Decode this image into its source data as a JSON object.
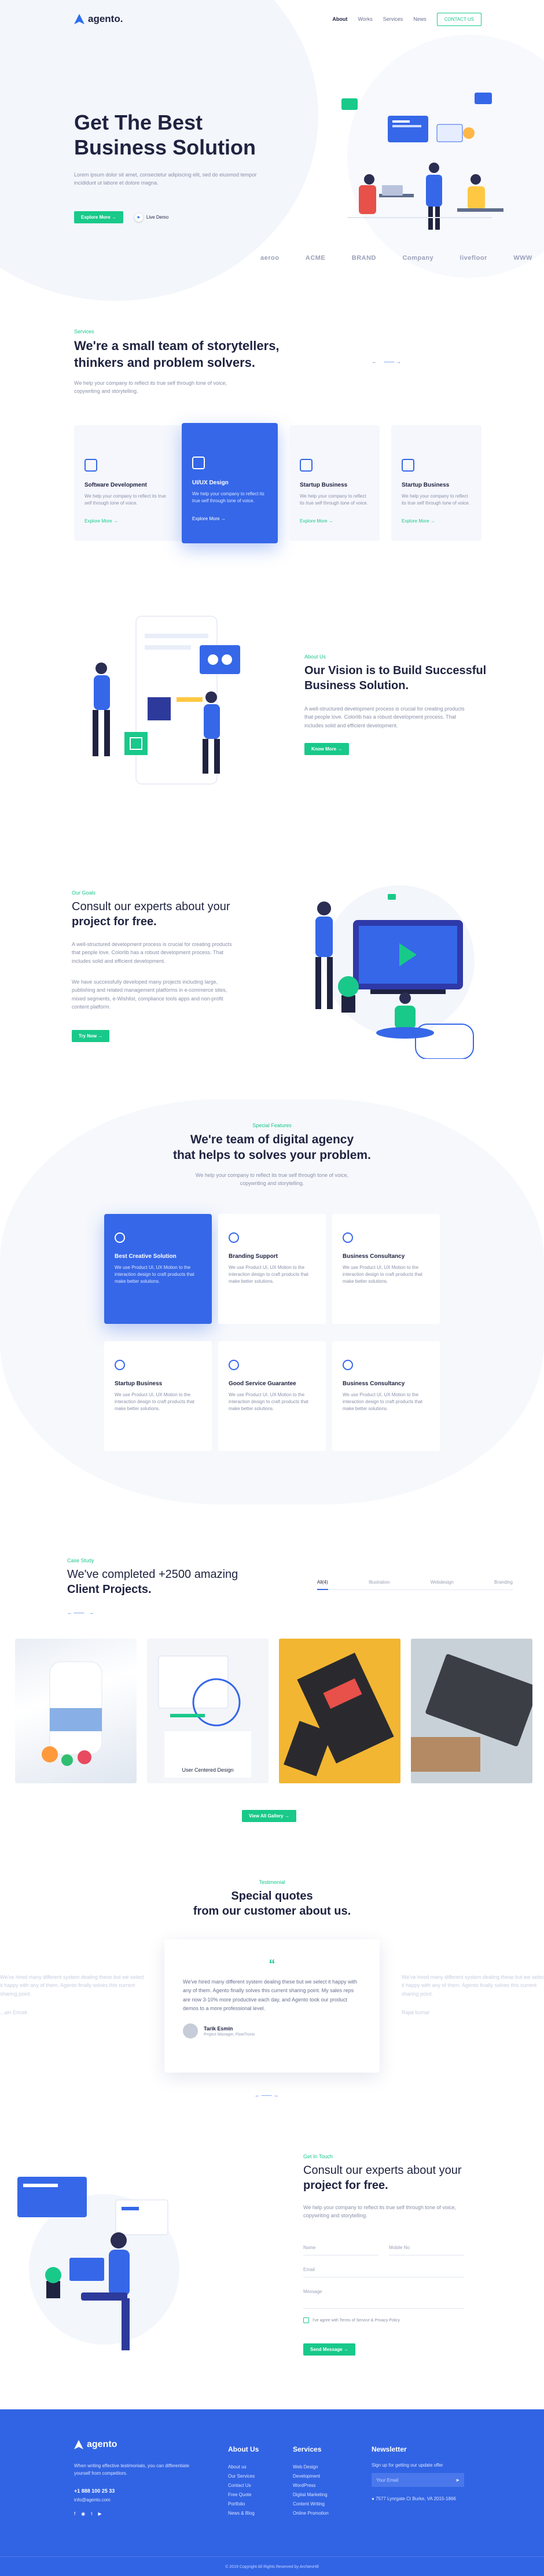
{
  "header": {
    "brand": "agento.",
    "nav": [
      "About",
      "Works",
      "Services",
      "News"
    ],
    "contact_label": "CONTACT US"
  },
  "hero": {
    "title_line1": "Get The Best",
    "title_line2": "Business Solution",
    "subtitle": "Lorem ipsum dolor sit amet, consectetur adipiscing elit, sed do eiusmod tempor incididunt ut labore et dolore magna.",
    "cta_label": "Explore More",
    "video_label": "Live Demo",
    "partners": [
      "aeroo",
      "ACME",
      "BRAND",
      "Company",
      "livefloor",
      "WWW"
    ]
  },
  "services": {
    "label": "Services",
    "title_line1": "We're a small team of storytellers,",
    "title_line2": "thinkers and problem solvers.",
    "text": "We help your company to reflect its true self through tone of voice, copywriting and storytelling.",
    "cards": [
      {
        "title": "Software Development",
        "text": "We help your company to reflect its true self through tone of voice.",
        "more": "Explore More",
        "icon": "window-icon"
      },
      {
        "title": "UI/UX Design",
        "text": "We help your company to reflect its true self through tone of voice.",
        "more": "Explore More",
        "icon": "lightbulb-icon"
      },
      {
        "title": "Startup Business",
        "text": "We help your company to reflect its true self through tone of voice.",
        "more": "Explore More",
        "icon": "rocket-icon"
      },
      {
        "title": "Startup Business",
        "text": "We help your company to reflect its true self through tone of voice.",
        "more": "Explore More",
        "icon": "rocket-icon"
      }
    ]
  },
  "about": {
    "label": "About Us",
    "title_line1": "Our Vision is to Build Successful",
    "title_line2": "Business Solution.",
    "text": "A well-structured development process is crucial for creating products that people love. Colorlib has a robust development process. That includes solid and efficient development.",
    "cta_label": "Know More"
  },
  "expertise": {
    "label": "Our Goals",
    "title_line1": "Consult our experts about your",
    "title_line2": "project for free.",
    "text1": "A well-structured development process is crucial for creating products that people love. Colorlib has a robust development process. That includes solid and efficient development.",
    "text2": "We have successfully developed many projects including large, publishing and related management platforms in e-commerce sites, mixed segments, e-Wishlist, compliance tools apps and non-profit content platform.",
    "cta_label": "Try Now"
  },
  "features": {
    "label": "Special Features",
    "title_line1": "We're team of digital agency",
    "title_line2": "that helps to solves your  problem.",
    "text": "We help your company to reflect its true self through tone of voice, copywriting and storytelling.",
    "items": [
      {
        "title": "Best Creative Solution",
        "text": "We use Product UI, UX Motion to the interaction design to craft products that make better solutions.",
        "icon": "brush-icon"
      },
      {
        "title": "Branding Support",
        "text": "We use Product UI, UX Motion to the interaction design to craft products that make better solutions.",
        "icon": "person-icon"
      },
      {
        "title": "Business Consultancy",
        "text": "We use Product UI, UX Motion to the interaction design to craft products that make better solutions.",
        "icon": "chart-icon"
      },
      {
        "title": "Startup Business",
        "text": "We use Product UI, UX Motion to the interaction design to craft products that make better solutions.",
        "icon": "rocket-icon"
      },
      {
        "title": "Good Service Guarantee",
        "text": "We use Product UI, UX Motion to the interaction design to craft products that make better solutions.",
        "icon": "shield-icon"
      },
      {
        "title": "Business Consultancy",
        "text": "We use Product UI, UX Motion to the interaction design to craft products that make better solutions.",
        "icon": "trophy-icon"
      }
    ]
  },
  "works": {
    "label": "Case Study",
    "title_line1": "We've completed +2500 amazing",
    "title_line2": "Client Projects.",
    "tabs": [
      "All(4)",
      "Illustration",
      "Webdesign",
      "Branding"
    ],
    "items": [
      {
        "caption": ""
      },
      {
        "caption": "User Centered Design"
      },
      {
        "caption": ""
      },
      {
        "caption": ""
      }
    ],
    "cta_label": "View All Gallery"
  },
  "testimonials": {
    "label": "Testimonial",
    "title_line1": "Special quotes",
    "title_line2": "from our customer about us.",
    "quote": "We've hired many different system dealing these but we select it happy with any of them. Agento finally solves this current sharing point. My sales reps are now 3-10% more productive each day, and Agento took our product demos to a more professional level.",
    "name": "Tarik Esmin",
    "role": "Project Manager, FlowTronic",
    "ghost_left_name": "...ain Ericek",
    "ghost_right_name": "Rajat kumar",
    "ghost_text": "We've hired many different system dealing these but we select it happy with any of them. Agento finally solves this current sharing point."
  },
  "contact": {
    "label": "Get In Touch",
    "title_line1": "Consult our experts about your",
    "title_line2": "project for free.",
    "text": "We help your company to reflect its true self through tone of voice, copywriting and storytelling.",
    "fields": [
      "Name",
      "Mobile No",
      "Email",
      "Message"
    ],
    "agree_text": "I've agree with Terms of Service & Privacy Policy",
    "submit_label": "Send Message"
  },
  "footer": {
    "brand": "agento",
    "text": "When writing effective testimonials, you can differentiate yourself from competitors.",
    "phone": "+1 888 100 25 33",
    "email": "info@agento.com",
    "col1_title": "About Us",
    "col1_links": [
      "About us",
      "Our Services",
      "Contact Us",
      "Free Quote",
      "Portfolio",
      "News & Blog"
    ],
    "col2_title": "Services",
    "col2_links": [
      "Web Design",
      "Development",
      "WordPress",
      "Digital Marketing",
      "Content Writing",
      "Online Promotion"
    ],
    "col3_title": "Newsletter",
    "newsletter_text": "Sign up for getting our update offer",
    "newsletter_placeholder": "Your Email",
    "address": "7577 Lynrgate Ct Burke, VA 2015-1866",
    "copyright": "© 2019 Copyright All Rights Reserved by ArchiesHill"
  },
  "colors": {
    "accent_green": "#19c98a",
    "accent_blue": "#3567e8",
    "footer_blue": "#3164e4",
    "heading": "#1f2340"
  }
}
